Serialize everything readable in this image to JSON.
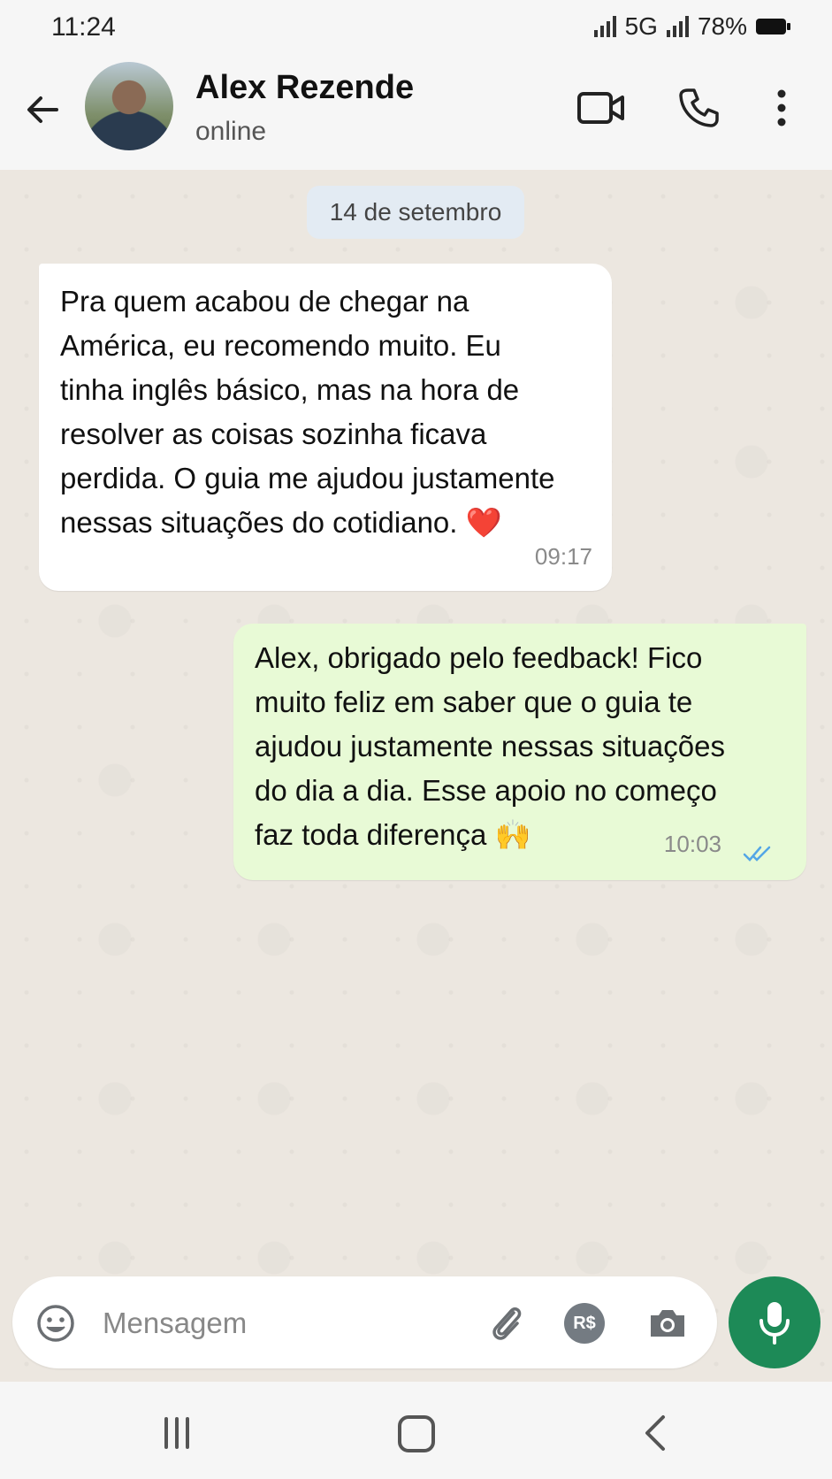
{
  "status_bar": {
    "time": "11:24",
    "network": "5G",
    "battery": "78%"
  },
  "header": {
    "contact_name": "Alex Rezende",
    "contact_status": "online"
  },
  "chat": {
    "date_divider": "14 de setembro",
    "messages": [
      {
        "direction": "incoming",
        "text": "Pra quem acabou de chegar na\nAmérica, eu recomendo muito. Eu\ntinha inglês básico, mas na hora de\nresolver as coisas sozinha ficava\nperdida. O guia me ajudou justamente\nnessas situações do cotidiano. ❤️",
        "time": "09:17"
      },
      {
        "direction": "outgoing",
        "text": "Alex, obrigado pelo feedback! Fico\nmuito feliz em saber que o guia te\najudou justamente nessas situações\ndo dia a dia. Esse apoio no começo\nfaz toda diferença 🙌",
        "time": "10:03",
        "read_status": "read"
      }
    ]
  },
  "composer": {
    "placeholder": "Mensagem",
    "payment_label": "R$"
  },
  "colors": {
    "incoming_bubble": "#ffffff",
    "outgoing_bubble": "#e8fad6",
    "accent": "#1d8a57",
    "read_ticks": "#53a6e6"
  }
}
